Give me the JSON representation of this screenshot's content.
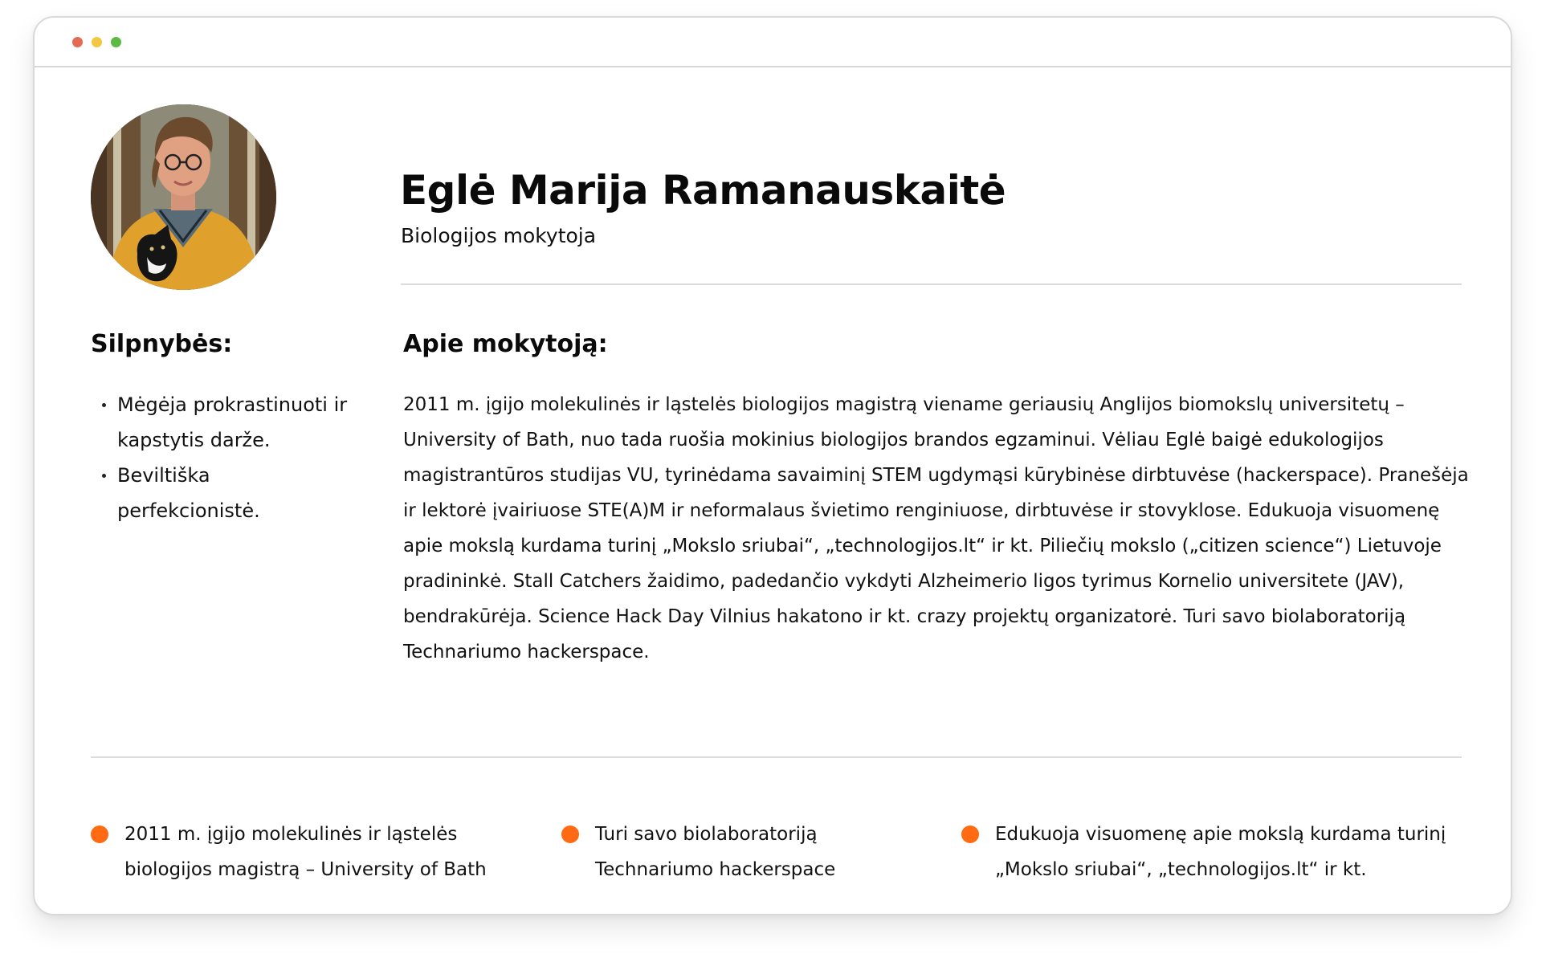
{
  "window": {
    "controls": [
      "close",
      "minimize",
      "maximize"
    ],
    "colors": {
      "close": "#e46a53",
      "minimize": "#f4c740",
      "maximize": "#5cb944"
    }
  },
  "profile": {
    "name": "Eglė Marija Ramanauskaitė",
    "role": "Biologijos mokytoja",
    "avatar_icon": "teacher-photo-with-cat"
  },
  "weaknesses": {
    "heading": "Silpnybės:",
    "items": [
      "Mėgėja prokrastinuoti ir kapstytis darže.",
      "Beviltiška perfekcionistė."
    ]
  },
  "about": {
    "heading": "Apie mokytoją:",
    "text": "2011 m. įgijo molekulinės ir ląstelės biologijos magistrą viename geriausių Anglijos biomokslų universitetų – University of Bath, nuo tada ruošia mokinius biologijos brandos egzaminui. Vėliau Eglė baigė edukologijos magistrantūros studijas VU, tyrinėdama savaiminį STEM ugdymąsi kūrybinėse dirbtuvėse (hackerspace). Pranešėja ir lektorė įvairiuose STE(A)M ir neformalaus švietimo renginiuose, dirbtuvėse ir stovyklose. Edukuoja visuomenę apie mokslą kurdama turinį „Mokslo sriubai“, „technologijos.lt“ ir kt. Piliečių mokslo („citizen science“) Lietuvoje pradininkė. Stall Catchers žaidimo, padedančio vykdyti Alzheimerio ligos tyrimus Kornelio universitete (JAV), bendrakūrėja. Science Hack Day Vilnius hakatono ir kt. crazy projektų organizatorė. Turi savo biolaboratoriją Technariumo hackerspace."
  },
  "highlights": {
    "marker_color": "#ff6a13",
    "items": [
      "2011 m. įgijo molekulinės ir ląstelės biologijos magistrą – University of Bath",
      "Turi savo biolaboratoriją Technariumo hackerspace",
      "Edukuoja visuomenę apie mokslą kurdama turinį „Mokslo sriubai“, „technologijos.lt“ ir kt."
    ]
  }
}
